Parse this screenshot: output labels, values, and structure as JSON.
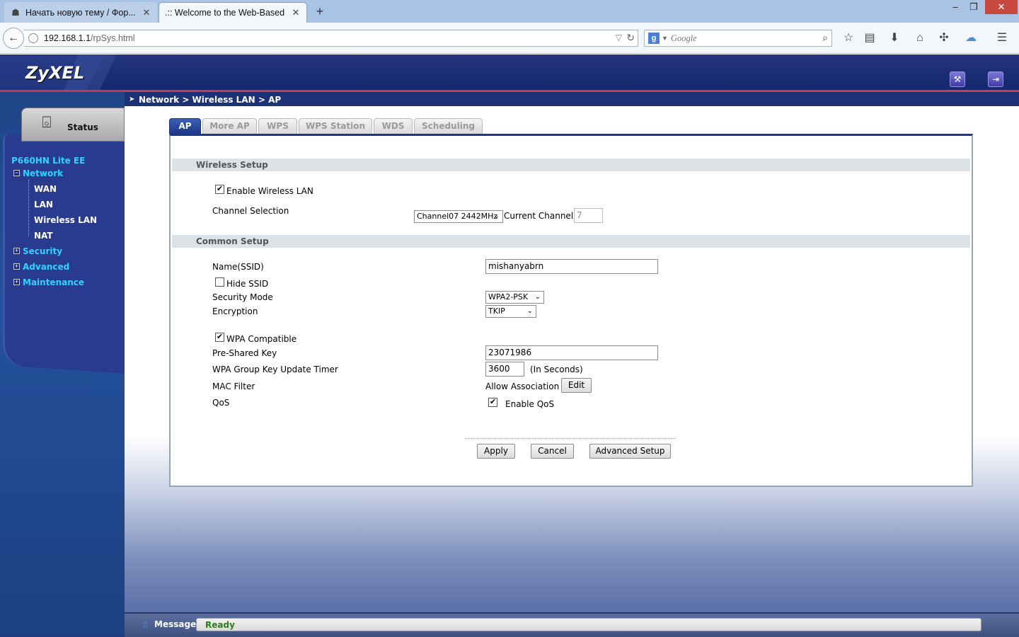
{
  "browser": {
    "tabs": [
      {
        "title": "Начать новую тему / Фор...",
        "icon": "forum-favicon",
        "active": false
      },
      {
        "title": ".:: Welcome to the Web-Based ...",
        "icon": "page-favicon",
        "active": true
      }
    ],
    "new_tab": "+",
    "window_controls": {
      "minimize": "–",
      "restore": "❐",
      "close": "✕"
    },
    "url_host": "192.168.1.1",
    "url_path": "/rpSys.html",
    "search_placeholder": "Google",
    "toolbar_icons": [
      "star-icon",
      "reading-list-icon",
      "download-icon",
      "home-icon",
      "share-icon",
      "weather-icon",
      "menu-icon"
    ]
  },
  "header": {
    "logo": "ZyXEL",
    "buttons": [
      "wizard-icon",
      "logout-icon"
    ]
  },
  "sidebar": {
    "status_label": "Status",
    "model": "P660HN Lite EE",
    "tree": [
      {
        "label": "Network",
        "expanded": true,
        "children": [
          "WAN",
          "LAN",
          "Wireless LAN",
          "NAT"
        ]
      },
      {
        "label": "Security",
        "expanded": false
      },
      {
        "label": "Advanced",
        "expanded": false
      },
      {
        "label": "Maintenance",
        "expanded": false
      }
    ]
  },
  "breadcrumb": "Network > Wireless LAN > AP",
  "tabs": [
    "AP",
    "More AP",
    "WPS",
    "WPS Station",
    "WDS",
    "Scheduling"
  ],
  "active_tab": "AP",
  "wireless_setup": {
    "heading": "Wireless Setup",
    "enable_wlan_label": "Enable Wireless LAN",
    "enable_wlan_checked": true,
    "channel_label": "Channel Selection",
    "channel_value": "Channel07 2442MHz",
    "current_channel_label": "Current Channel:",
    "current_channel_value": "7"
  },
  "common_setup": {
    "heading": "Common Setup",
    "ssid_label": "Name(SSID)",
    "ssid_value": "mishanyabrn",
    "hide_ssid_label": "Hide SSID",
    "hide_ssid_checked": false,
    "security_mode_label": "Security Mode",
    "security_mode_value": "WPA2-PSK",
    "encryption_label": "Encryption",
    "encryption_value": "TKIP",
    "wpa_compatible_label": "WPA Compatible",
    "wpa_compatible_checked": true,
    "psk_label": "Pre-Shared Key",
    "psk_value": "23071986",
    "group_key_label": "WPA Group Key Update Timer",
    "group_key_value": "3600",
    "group_key_unit": "(In Seconds)",
    "mac_filter_label": "MAC Filter",
    "mac_filter_value": "Allow Association",
    "mac_filter_button": "Edit",
    "qos_label": "QoS",
    "qos_option_label": "Enable QoS",
    "qos_checked": true
  },
  "actions": {
    "apply": "Apply",
    "cancel": "Cancel",
    "advanced": "Advanced Setup"
  },
  "status_bar": {
    "label": "Message",
    "text": "Ready"
  },
  "colors": {
    "header_blue": "#1a2c73",
    "accent_red": "#c33a52",
    "nav_cyan": "#2fd3ff",
    "ready_green": "#2e7d1c"
  }
}
